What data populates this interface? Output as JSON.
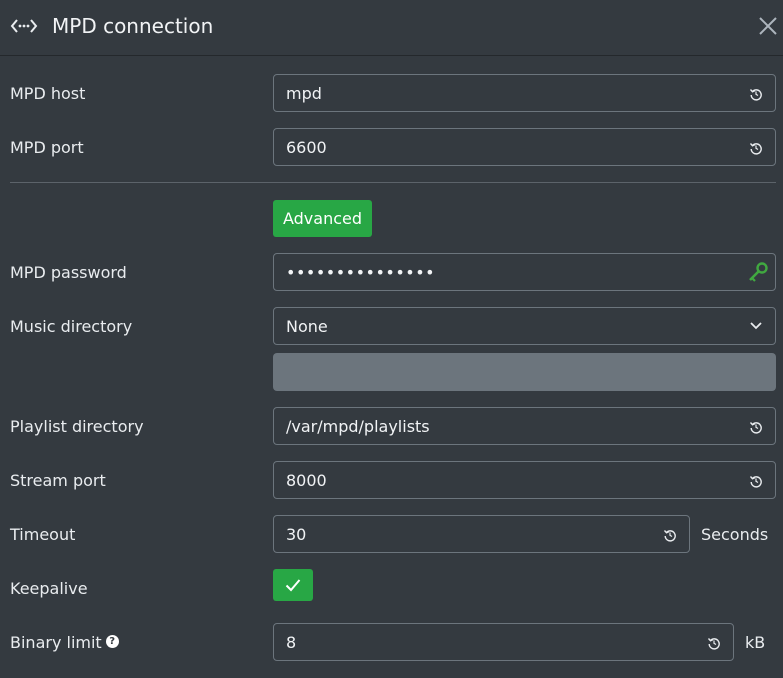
{
  "header": {
    "title": "MPD connection",
    "icon": "code-arrows-icon",
    "close_icon": "close-icon"
  },
  "fields": {
    "host": {
      "label": "MPD host",
      "value": "mpd"
    },
    "port": {
      "label": "MPD port",
      "value": "6600"
    },
    "advanced_button": "Advanced",
    "password": {
      "label": "MPD password",
      "value": "•••••••••••••••",
      "icon": "key-icon",
      "icon_color": "#40a840"
    },
    "music_directory": {
      "label": "Music directory",
      "value": "None"
    },
    "playlist_directory": {
      "label": "Playlist directory",
      "value": "/var/mpd/playlists"
    },
    "stream_port": {
      "label": "Stream port",
      "value": "8000"
    },
    "timeout": {
      "label": "Timeout",
      "value": "30",
      "unit": "Seconds"
    },
    "keepalive": {
      "label": "Keepalive",
      "checked": true
    },
    "binary_limit": {
      "label": "Binary limit",
      "value": "8",
      "unit": "kB",
      "help": "?"
    }
  },
  "colors": {
    "background": "#343a40",
    "accent": "#28a745",
    "border": "#6c757d"
  }
}
